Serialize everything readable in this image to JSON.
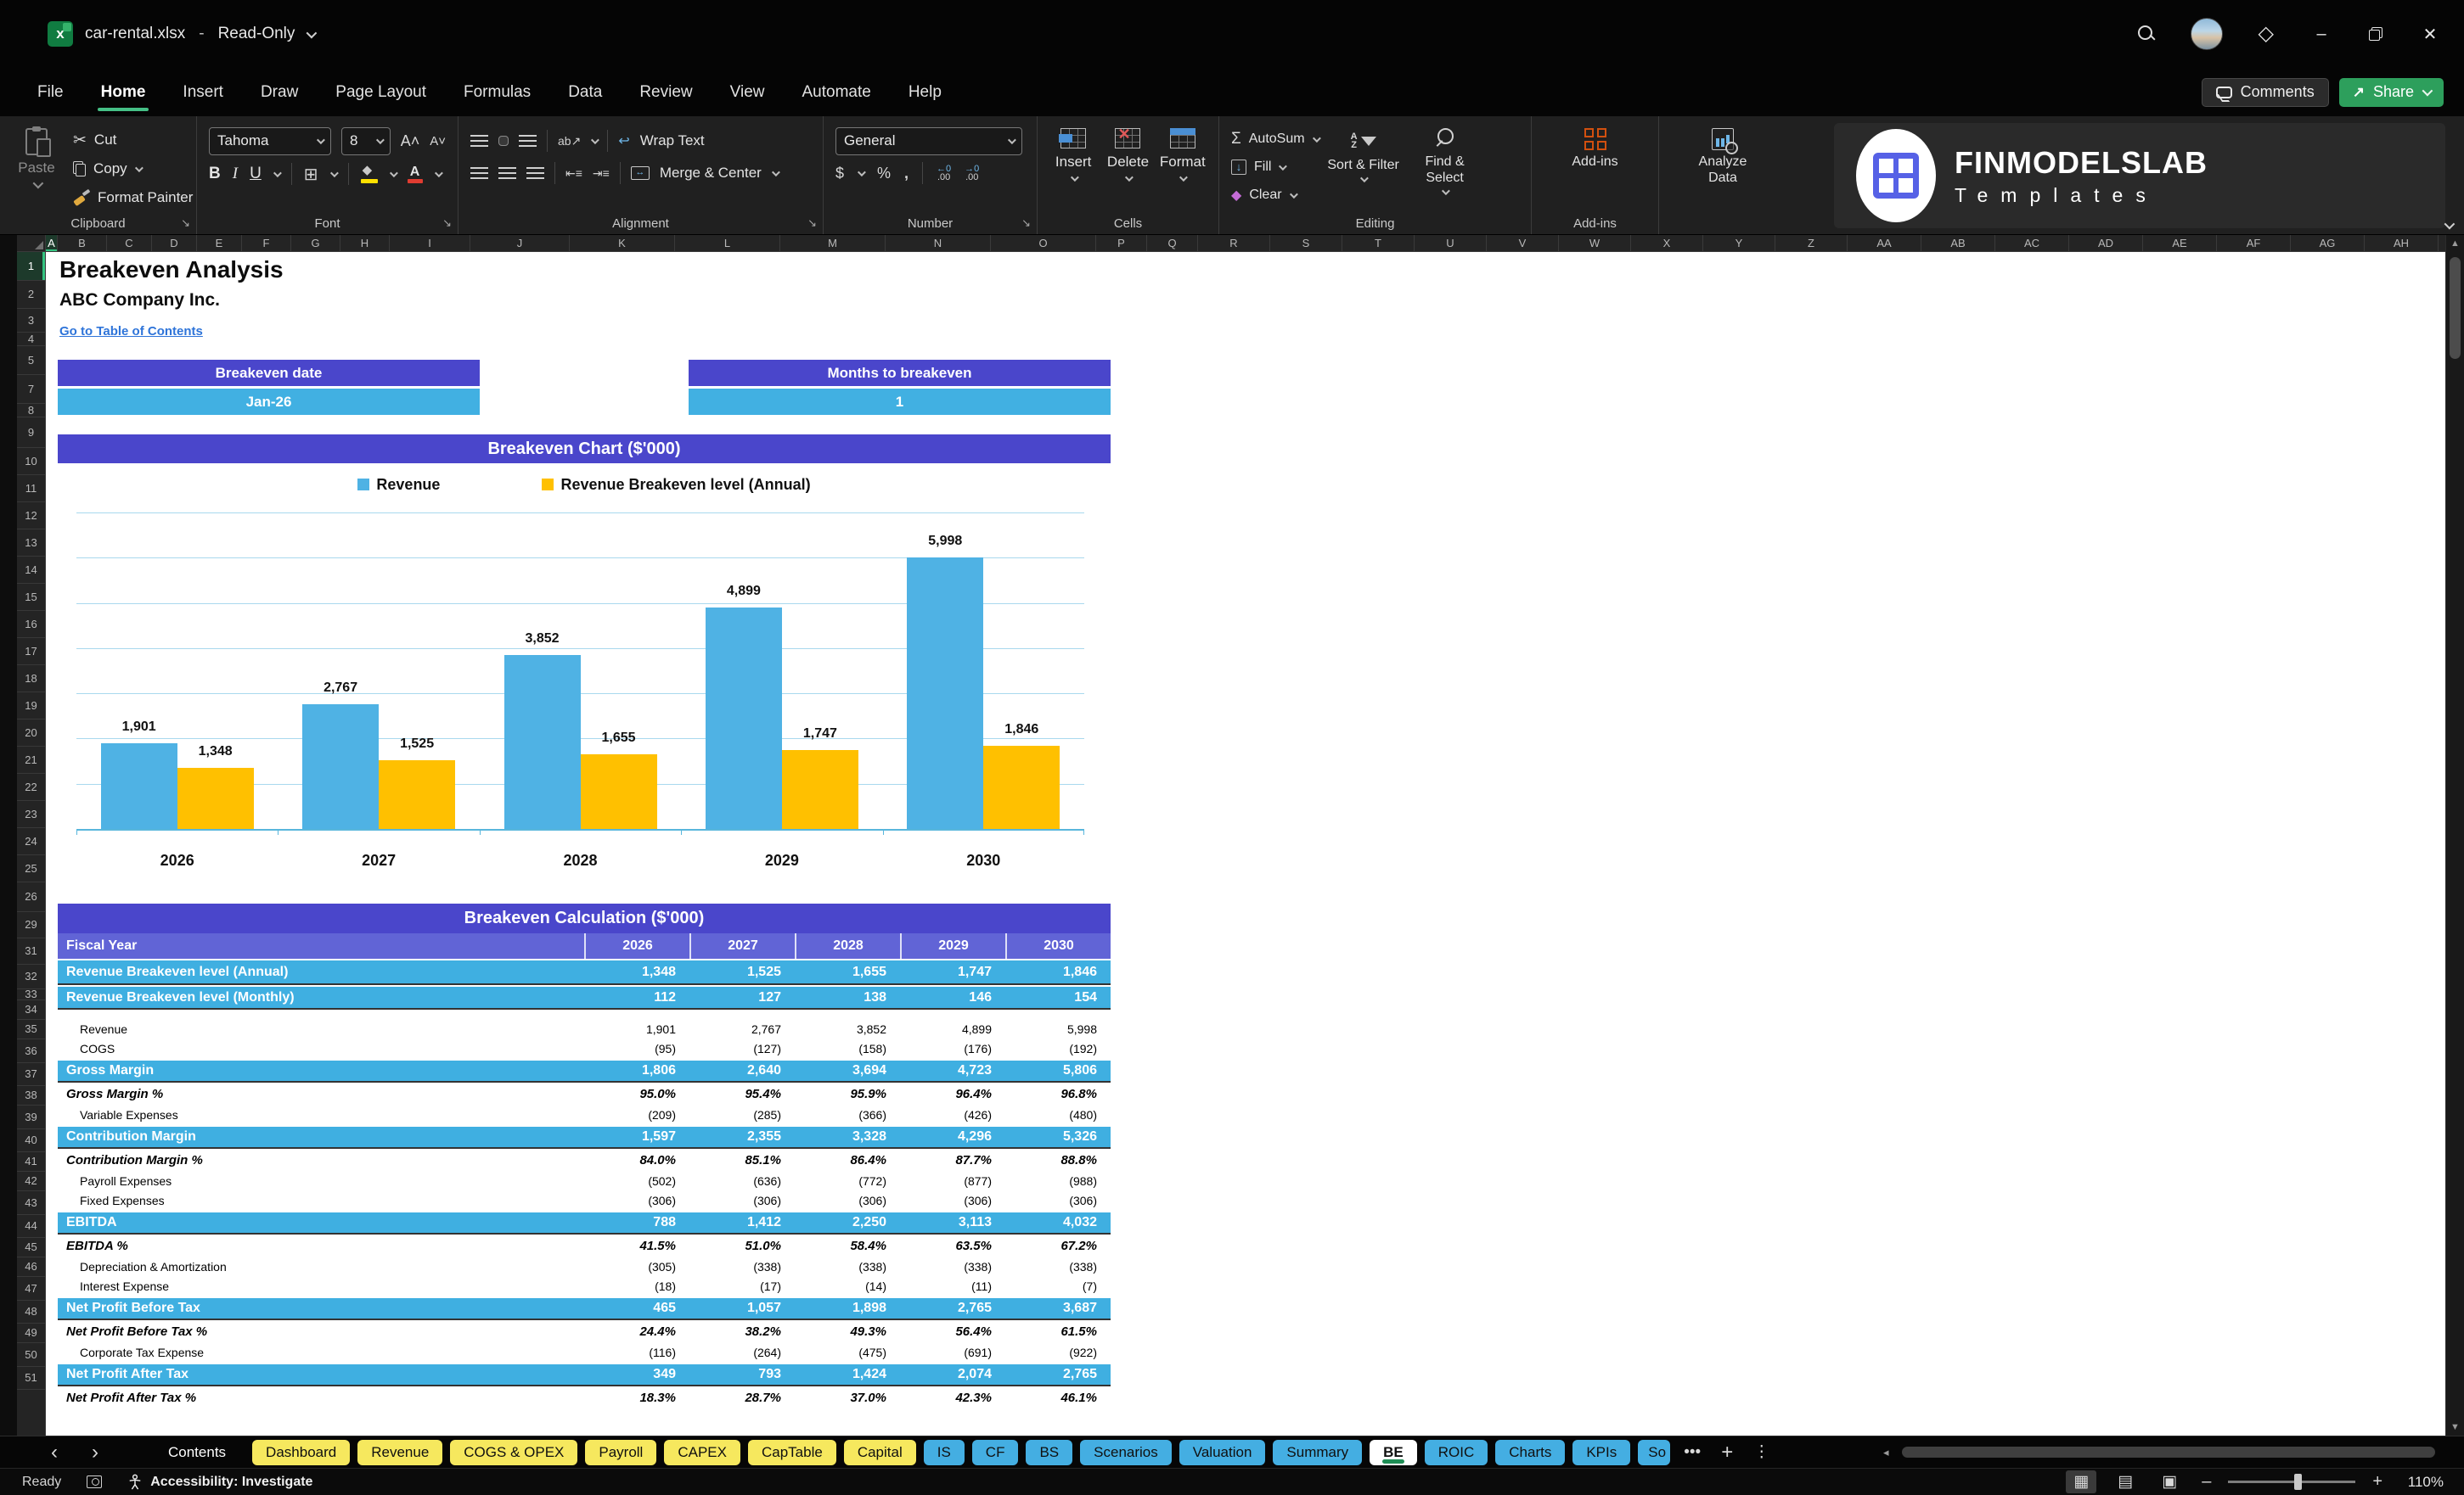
{
  "titlebar": {
    "file_name": "car-rental.xlsx",
    "separator": "-",
    "mode": "Read-Only"
  },
  "ribbon": {
    "tabs": [
      {
        "label": "File",
        "active": false
      },
      {
        "label": "Home",
        "active": true
      },
      {
        "label": "Insert",
        "active": false
      },
      {
        "label": "Draw",
        "active": false
      },
      {
        "label": "Page Layout",
        "active": false
      },
      {
        "label": "Formulas",
        "active": false
      },
      {
        "label": "Data",
        "active": false
      },
      {
        "label": "Review",
        "active": false
      },
      {
        "label": "View",
        "active": false
      },
      {
        "label": "Automate",
        "active": false
      },
      {
        "label": "Help",
        "active": false
      }
    ],
    "clipboard": {
      "label": "Clipboard",
      "paste": "Paste",
      "cut": "Cut",
      "copy": "Copy",
      "format_painter": "Format Painter"
    },
    "font": {
      "label": "Font",
      "font_name": "Tahoma",
      "font_size": "8"
    },
    "alignment": {
      "label": "Alignment",
      "wrap_text": "Wrap Text",
      "merge_center": "Merge & Center"
    },
    "number": {
      "label": "Number",
      "format": "General"
    },
    "cells": {
      "label": "Cells",
      "insert": "Insert",
      "delete": "Delete",
      "format": "Format"
    },
    "editing": {
      "label": "Editing",
      "autosum": "AutoSum",
      "fill": "Fill",
      "clear": "Clear",
      "sort_filter": "Sort & Filter",
      "find_select": "Find & Select"
    },
    "addins": {
      "label": "Add-ins",
      "addins_label": "Add-ins",
      "analyze_label": "Analyze Data"
    },
    "comments_label": "Comments",
    "share_label": "Share"
  },
  "logo": {
    "brand": "FINMODELSLAB",
    "sub": "Templates"
  },
  "grid": {
    "columns": [
      {
        "label": "A",
        "w": 14,
        "sel": true
      },
      {
        "label": "B",
        "w": 58
      },
      {
        "label": "C",
        "w": 53
      },
      {
        "label": "D",
        "w": 53
      },
      {
        "label": "E",
        "w": 53
      },
      {
        "label": "F",
        "w": 58
      },
      {
        "label": "G",
        "w": 58
      },
      {
        "label": "H",
        "w": 58
      },
      {
        "label": "I",
        "w": 95
      },
      {
        "label": "J",
        "w": 117
      },
      {
        "label": "K",
        "w": 124
      },
      {
        "label": "L",
        "w": 124
      },
      {
        "label": "M",
        "w": 124
      },
      {
        "label": "N",
        "w": 124
      },
      {
        "label": "O",
        "w": 124
      },
      {
        "label": "P",
        "w": 60
      },
      {
        "label": "Q",
        "w": 60
      },
      {
        "label": "R",
        "w": 85
      },
      {
        "label": "S",
        "w": 85
      },
      {
        "label": "T",
        "w": 85
      },
      {
        "label": "U",
        "w": 85
      },
      {
        "label": "V",
        "w": 85
      },
      {
        "label": "W",
        "w": 85
      },
      {
        "label": "X",
        "w": 85
      },
      {
        "label": "Y",
        "w": 85
      },
      {
        "label": "Z",
        "w": 85
      },
      {
        "label": "AA",
        "w": 87
      },
      {
        "label": "AB",
        "w": 87
      },
      {
        "label": "AC",
        "w": 87
      },
      {
        "label": "AD",
        "w": 87
      },
      {
        "label": "AE",
        "w": 87
      },
      {
        "label": "AF",
        "w": 87
      },
      {
        "label": "AG",
        "w": 87
      },
      {
        "label": "AH",
        "w": 87
      }
    ],
    "rows": [
      {
        "n": "1",
        "h": 34,
        "sel": true
      },
      {
        "n": "2",
        "h": 33
      },
      {
        "n": "3",
        "h": 28
      },
      {
        "n": "4",
        "h": 16
      },
      {
        "n": "5",
        "h": 34
      },
      {
        "n": "7",
        "h": 34
      },
      {
        "n": "8",
        "h": 16
      },
      {
        "n": "9",
        "h": 36
      },
      {
        "n": "10",
        "h": 32
      },
      {
        "n": "11",
        "h": 32
      },
      {
        "n": "12",
        "h": 32
      },
      {
        "n": "13",
        "h": 32
      },
      {
        "n": "14",
        "h": 32
      },
      {
        "n": "15",
        "h": 32
      },
      {
        "n": "16",
        "h": 32
      },
      {
        "n": "17",
        "h": 32
      },
      {
        "n": "18",
        "h": 32
      },
      {
        "n": "19",
        "h": 32
      },
      {
        "n": "20",
        "h": 32
      },
      {
        "n": "21",
        "h": 32
      },
      {
        "n": "22",
        "h": 32
      },
      {
        "n": "23",
        "h": 32
      },
      {
        "n": "24",
        "h": 32
      },
      {
        "n": "25",
        "h": 32
      },
      {
        "n": "26",
        "h": 35
      },
      {
        "n": "29",
        "h": 31
      },
      {
        "n": "31",
        "h": 31
      },
      {
        "n": "32",
        "h": 29
      },
      {
        "n": "33",
        "h": 13
      },
      {
        "n": "34",
        "h": 23
      },
      {
        "n": "35",
        "h": 23
      },
      {
        "n": "36",
        "h": 28
      },
      {
        "n": "37",
        "h": 27
      },
      {
        "n": "38",
        "h": 23
      },
      {
        "n": "39",
        "h": 28
      },
      {
        "n": "40",
        "h": 27
      },
      {
        "n": "41",
        "h": 23
      },
      {
        "n": "42",
        "h": 23
      },
      {
        "n": "43",
        "h": 28
      },
      {
        "n": "44",
        "h": 27
      },
      {
        "n": "45",
        "h": 23
      },
      {
        "n": "46",
        "h": 23
      },
      {
        "n": "47",
        "h": 28
      },
      {
        "n": "48",
        "h": 27
      },
      {
        "n": "49",
        "h": 23
      },
      {
        "n": "50",
        "h": 28
      },
      {
        "n": "51",
        "h": 27
      }
    ]
  },
  "sheet": {
    "title": "Breakeven Analysis",
    "company": "ABC Company Inc.",
    "link": "Go to Table of Contents",
    "kpis": [
      {
        "header": "Breakeven date",
        "value": "Jan-26"
      },
      {
        "header": "Months to breakeven",
        "value": "1"
      }
    ]
  },
  "chart_data": {
    "type": "bar",
    "title": "Breakeven Chart ($'000)",
    "categories": [
      "2026",
      "2027",
      "2028",
      "2029",
      "2030"
    ],
    "series": [
      {
        "name": "Revenue",
        "color": "#4fb2e4",
        "values": [
          1901,
          2767,
          3852,
          4899,
          5998
        ],
        "labels": [
          "1,901",
          "2,767",
          "3,852",
          "4,899",
          "5,998"
        ]
      },
      {
        "name": "Revenue Breakeven level (Annual)",
        "color": "#ffc000",
        "values": [
          1348,
          1525,
          1655,
          1747,
          1846
        ],
        "labels": [
          "1,348",
          "1,525",
          "1,655",
          "1,747",
          "1,846"
        ]
      }
    ],
    "xlabel": "",
    "ylabel": "",
    "ylim": [
      0,
      7000
    ],
    "gridline_step": 1000,
    "grid": true,
    "legend_position": "top",
    "y_axis_labels": false
  },
  "table": {
    "banner": "Breakeven Calculation ($'000)",
    "header": {
      "label": "Fiscal Year",
      "years": [
        "2026",
        "2027",
        "2028",
        "2029",
        "2030"
      ]
    },
    "rows": [
      {
        "label": "Revenue Breakeven level (Annual)",
        "values": [
          "1,348",
          "1,525",
          "1,655",
          "1,747",
          "1,846"
        ],
        "style": "highlight",
        "h": 31
      },
      {
        "label": "Revenue Breakeven level (Monthly)",
        "values": [
          "112",
          "127",
          "138",
          "146",
          "154"
        ],
        "style": "highlight",
        "h": 29
      },
      {
        "label": "",
        "values": [],
        "style": "spacer",
        "h": 12
      },
      {
        "label": "Revenue",
        "values": [
          "1,901",
          "2,767",
          "3,852",
          "4,899",
          "5,998"
        ],
        "style": "normal",
        "h": 23
      },
      {
        "label": "COGS",
        "values": [
          "(95)",
          "(127)",
          "(158)",
          "(176)",
          "(192)"
        ],
        "style": "normal",
        "h": 23
      },
      {
        "label": "Gross Margin",
        "values": [
          "1,806",
          "2,640",
          "3,694",
          "4,723",
          "5,806"
        ],
        "style": "highlight",
        "h": 28
      },
      {
        "label": "Gross Margin %",
        "values": [
          "95.0%",
          "95.4%",
          "95.9%",
          "96.4%",
          "96.8%"
        ],
        "style": "percent",
        "h": 27
      },
      {
        "label": "Variable Expenses",
        "values": [
          "(209)",
          "(285)",
          "(366)",
          "(426)",
          "(480)"
        ],
        "style": "normal",
        "h": 23
      },
      {
        "label": "Contribution Margin",
        "values": [
          "1,597",
          "2,355",
          "3,328",
          "4,296",
          "5,326"
        ],
        "style": "highlight",
        "h": 28
      },
      {
        "label": "Contribution Margin %",
        "values": [
          "84.0%",
          "85.1%",
          "86.4%",
          "87.7%",
          "88.8%"
        ],
        "style": "percent",
        "h": 27
      },
      {
        "label": "Payroll Expenses",
        "values": [
          "(502)",
          "(636)",
          "(772)",
          "(877)",
          "(988)"
        ],
        "style": "normal",
        "h": 23
      },
      {
        "label": "Fixed Expenses",
        "values": [
          "(306)",
          "(306)",
          "(306)",
          "(306)",
          "(306)"
        ],
        "style": "normal",
        "h": 23
      },
      {
        "label": "EBITDA",
        "values": [
          "788",
          "1,412",
          "2,250",
          "3,113",
          "4,032"
        ],
        "style": "highlight",
        "h": 28
      },
      {
        "label": "EBITDA %",
        "values": [
          "41.5%",
          "51.0%",
          "58.4%",
          "63.5%",
          "67.2%"
        ],
        "style": "percent",
        "h": 27
      },
      {
        "label": "Depreciation & Amortization",
        "values": [
          "(305)",
          "(338)",
          "(338)",
          "(338)",
          "(338)"
        ],
        "style": "normal",
        "h": 23
      },
      {
        "label": "Interest Expense",
        "values": [
          "(18)",
          "(17)",
          "(14)",
          "(11)",
          "(7)"
        ],
        "style": "normal",
        "h": 23
      },
      {
        "label": "Net Profit Before Tax",
        "values": [
          "465",
          "1,057",
          "1,898",
          "2,765",
          "3,687"
        ],
        "style": "highlight",
        "h": 28
      },
      {
        "label": "Net Profit Before Tax %",
        "values": [
          "24.4%",
          "38.2%",
          "49.3%",
          "56.4%",
          "61.5%"
        ],
        "style": "percent",
        "h": 27
      },
      {
        "label": "Corporate Tax Expense",
        "values": [
          "(116)",
          "(264)",
          "(475)",
          "(691)",
          "(922)"
        ],
        "style": "normal",
        "h": 23
      },
      {
        "label": "Net Profit After Tax",
        "values": [
          "349",
          "793",
          "1,424",
          "2,074",
          "2,765"
        ],
        "style": "highlight",
        "h": 28
      },
      {
        "label": "Net Profit After Tax %",
        "values": [
          "18.3%",
          "28.7%",
          "37.0%",
          "42.3%",
          "46.1%"
        ],
        "style": "percent",
        "h": 27
      }
    ]
  },
  "sheet_tabs": {
    "tabs": [
      {
        "label": "Contents",
        "type": "dark"
      },
      {
        "label": "Dashboard",
        "type": "yellow"
      },
      {
        "label": "Revenue",
        "type": "yellow"
      },
      {
        "label": "COGS & OPEX",
        "type": "yellow"
      },
      {
        "label": "Payroll",
        "type": "yellow"
      },
      {
        "label": "CAPEX",
        "type": "yellow"
      },
      {
        "label": "CapTable",
        "type": "yellow"
      },
      {
        "label": "Capital",
        "type": "yellow"
      },
      {
        "label": "IS",
        "type": "blue"
      },
      {
        "label": "CF",
        "type": "blue"
      },
      {
        "label": "BS",
        "type": "blue"
      },
      {
        "label": "Scenarios",
        "type": "blue"
      },
      {
        "label": "Valuation",
        "type": "blue"
      },
      {
        "label": "Summary",
        "type": "blue"
      },
      {
        "label": "BE",
        "type": "active"
      },
      {
        "label": "ROIC",
        "type": "blue"
      },
      {
        "label": "Charts",
        "type": "blue"
      },
      {
        "label": "KPIs",
        "type": "blue"
      },
      {
        "label": "So",
        "type": "blue",
        "cut": true
      }
    ]
  },
  "statusbar": {
    "ready": "Ready",
    "accessibility": "Accessibility: Investigate",
    "zoom_level": "110%"
  },
  "colors": {
    "accent_purple": "#4a46cb",
    "header_purple": "#6164d6",
    "highlight_blue": "#3fafe1",
    "bar_blue": "#4fb2e4",
    "bar_yellow": "#ffc000",
    "link_blue": "#2e74d9",
    "tab_yellow": "#f6e85e",
    "tab_blue": "#44aee2",
    "active_green": "#1e8e55",
    "share_green": "#2d9f5c"
  }
}
